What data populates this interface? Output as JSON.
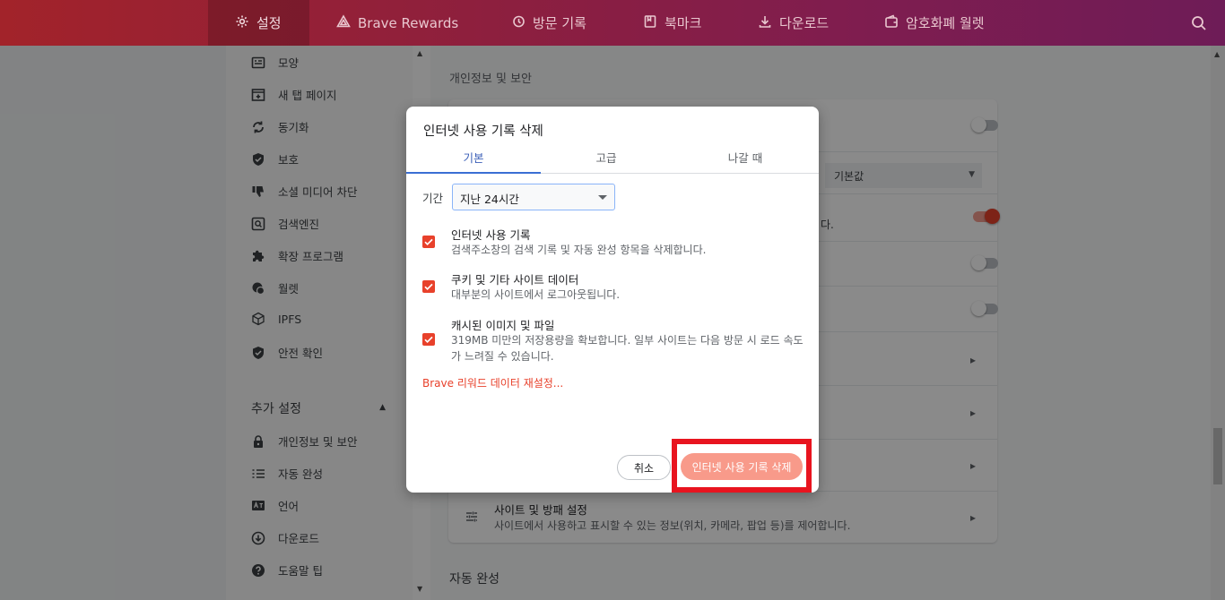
{
  "topbar": {
    "tabs": [
      {
        "label": "설정",
        "icon": "gear-icon"
      },
      {
        "label": "Brave Rewards",
        "icon": "triangle-icon"
      },
      {
        "label": "방문 기록",
        "icon": "history-icon"
      },
      {
        "label": "북마크",
        "icon": "bookmark-icon"
      },
      {
        "label": "다운로드",
        "icon": "download-icon"
      },
      {
        "label": "암호화폐 월렛",
        "icon": "wallet-icon"
      }
    ]
  },
  "sidebar": {
    "items": [
      {
        "label": "모양"
      },
      {
        "label": "새 탭 페이지"
      },
      {
        "label": "동기화"
      },
      {
        "label": "보호"
      },
      {
        "label": "소셜 미디어 차단"
      },
      {
        "label": "검색엔진"
      },
      {
        "label": "확장 프로그램"
      },
      {
        "label": "월렛"
      },
      {
        "label": "IPFS"
      },
      {
        "label": "안전 확인"
      }
    ],
    "advanced_header": "추가 설정",
    "advanced_items": [
      {
        "label": "개인정보 및 보안"
      },
      {
        "label": "자동 완성"
      },
      {
        "label": "언어"
      },
      {
        "label": "다운로드"
      },
      {
        "label": "도움말 팁"
      }
    ]
  },
  "main": {
    "section_title": "개인정보 및 보안",
    "default_value": "기본값",
    "partial_text": "다.",
    "site_settings_title": "사이트 및 방패 설정",
    "site_settings_desc": "사이트에서 사용하고 표시할 수 있는 정보(위치, 카메라, 팝업 등)를 제어합니다.",
    "next_section_title": "자동 완성"
  },
  "dialog": {
    "title": "인터넷 사용 기록 삭제",
    "tabs": [
      "기본",
      "고급",
      "나갈 때"
    ],
    "period_label": "기간",
    "period_value": "지난 24시간",
    "checkboxes": [
      {
        "title": "인터넷 사용 기록",
        "desc": "검색주소창의 검색 기록 및 자동 완성 항목을 삭제합니다.",
        "checked": true
      },
      {
        "title": "쿠키 및 기타 사이트 데이터",
        "desc": "대부분의 사이트에서 로그아웃됩니다.",
        "checked": true
      },
      {
        "title": "캐시된 이미지 및 파일",
        "desc": "319MB 미만의 저장용량을 확보합니다. 일부 사이트는 다음 방문 시 로드 속도가 느려질 수 있습니다.",
        "checked": true
      }
    ],
    "reset_link": "Brave 리워드 데이터 재설정...",
    "cancel_label": "취소",
    "delete_label": "인터넷 사용 기록 삭제"
  },
  "colors": {
    "accent": "#e8412b",
    "tab_active": "#3b5fb8",
    "highlight": "#e8141f"
  }
}
